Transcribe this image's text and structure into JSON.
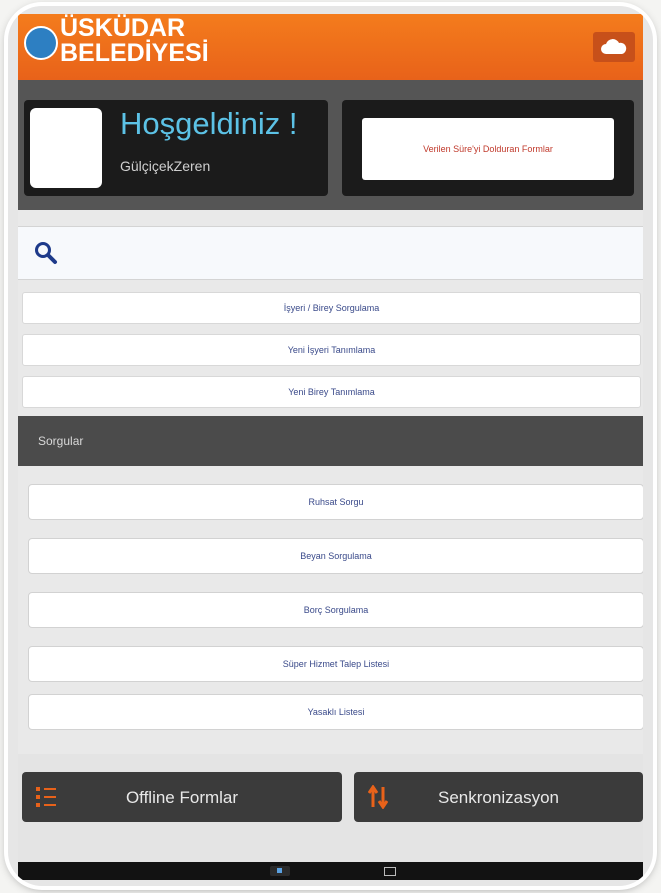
{
  "header": {
    "logo_line1": "ÜSKÜDAR",
    "logo_line2": "BELEDİYESİ",
    "cloud_icon": "cloud-icon"
  },
  "welcome": {
    "title": "Hoşgeldiniz !",
    "user": "GülçiçekZeren",
    "forms_button": "Verilen Süre'yi Dolduran Formlar"
  },
  "search": {
    "placeholder": "",
    "icon": "search-icon"
  },
  "actions": [
    {
      "label": "İşyeri / Birey Sorgulama"
    },
    {
      "label": "Yeni İşyeri Tanımlama"
    },
    {
      "label": "Yeni Birey Tanımlama"
    }
  ],
  "section": {
    "title": "Sorgular"
  },
  "queries": [
    {
      "label": "Ruhsat Sorgu"
    },
    {
      "label": "Beyan Sorgulama"
    },
    {
      "label": "Borç Sorgulama"
    },
    {
      "label": "Süper Hizmet Talep Listesi"
    },
    {
      "label": "Yasaklı Listesi"
    }
  ],
  "bottom": {
    "offline_label": "Offline Formlar",
    "sync_label": "Senkronizasyon"
  },
  "colors": {
    "brand_orange": "#e8621a",
    "welcome_blue": "#5cc2e6",
    "dark_panel": "#1b1b1b"
  }
}
